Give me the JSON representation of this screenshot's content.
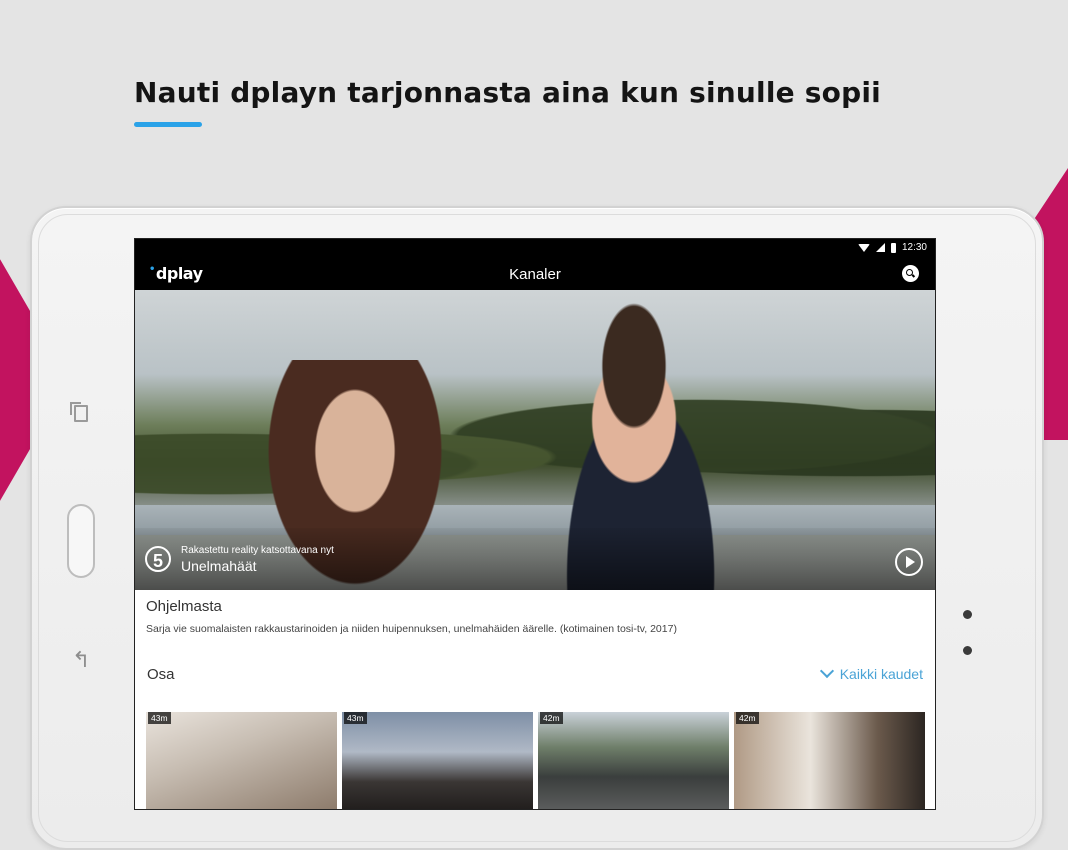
{
  "headline": "Nauti dplayn tarjonnasta aina kun sinulle sopii",
  "colors": {
    "accent_blue": "#2aa2e8",
    "magenta": "#c2135f",
    "link_blue": "#4aa3d6"
  },
  "status_bar": {
    "time": "12:30",
    "icons": [
      "wifi-icon",
      "signal-icon",
      "battery-icon"
    ]
  },
  "app_bar": {
    "logo": "dplay",
    "title": "Kanaler",
    "search_icon": "search-icon"
  },
  "hero": {
    "channel_logo": "5",
    "subtitle": "Rakastettu reality katsottavana nyt",
    "title": "Unelmahäät",
    "play_icon": "play-icon"
  },
  "about": {
    "heading": "Ohjelmasta",
    "text": "Sarja vie suomalaisten rakkaustarinoiden ja niiden huipennuksen, unelmahäiden äärelle. (kotimainen tosi-tv, 2017)"
  },
  "episodes": {
    "heading": "Osa",
    "all_seasons_label": "Kaikki kaudet",
    "thumbnails": [
      {
        "duration": "43m"
      },
      {
        "duration": "43m"
      },
      {
        "duration": "42m"
      },
      {
        "duration": "42m"
      }
    ]
  }
}
